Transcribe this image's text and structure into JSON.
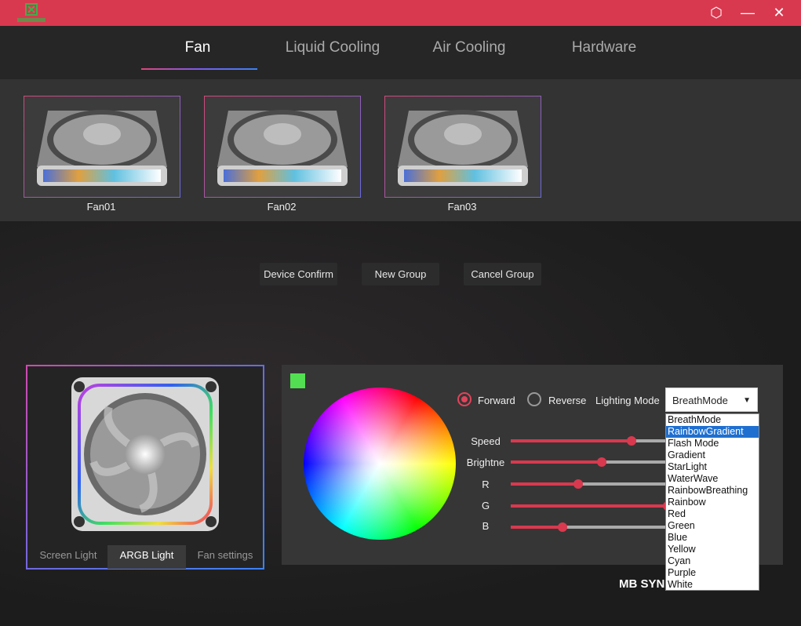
{
  "window": {
    "logo_icon": "app-logo-icon",
    "controls": {
      "settings_icon": "⬡",
      "minimize_icon": "—",
      "close_icon": "✕"
    }
  },
  "tabs": [
    {
      "label": "Fan",
      "active": true
    },
    {
      "label": "Liquid Cooling",
      "active": false
    },
    {
      "label": "Air Cooling",
      "active": false
    },
    {
      "label": "Hardware",
      "active": false
    }
  ],
  "devices": [
    {
      "label": "Fan01"
    },
    {
      "label": "Fan02"
    },
    {
      "label": "Fan03"
    }
  ],
  "actions": {
    "device_confirm": "Device Confirm",
    "new_group": "New Group",
    "cancel_group": "Cancel Group"
  },
  "preview": {
    "tabs": [
      {
        "label": "Screen Light",
        "active": false
      },
      {
        "label": "ARGB Light",
        "active": true
      },
      {
        "label": "Fan settings",
        "active": false
      }
    ]
  },
  "lighting": {
    "selected_color": "#52e052",
    "direction": {
      "forward": "Forward",
      "reverse": "Reverse",
      "selected": "Forward"
    },
    "mode_label": "Lighting Mode",
    "mode_value": "BreathMode",
    "sliders": [
      {
        "label": "Speed",
        "value": 0.77
      },
      {
        "label": "Brightne",
        "value": 0.58
      },
      {
        "label": "R",
        "value": 0.43
      },
      {
        "label": "G",
        "value": 1.0
      },
      {
        "label": "B",
        "value": 0.33
      }
    ],
    "mode_options": [
      "BreathMode",
      "RainbowGradient",
      "Flash Mode",
      "Gradient",
      "StarLight",
      "WaterWave",
      "RainbowBreathing",
      "Rainbow",
      "Red",
      "Green",
      "Blue",
      "Yellow",
      "Cyan",
      "Purple",
      "White"
    ],
    "highlighted_option": "RainbowGradient"
  },
  "brand_text": "MB SYN",
  "colors": {
    "accent": "#d9394f",
    "highlight": "#1f6fd0"
  }
}
